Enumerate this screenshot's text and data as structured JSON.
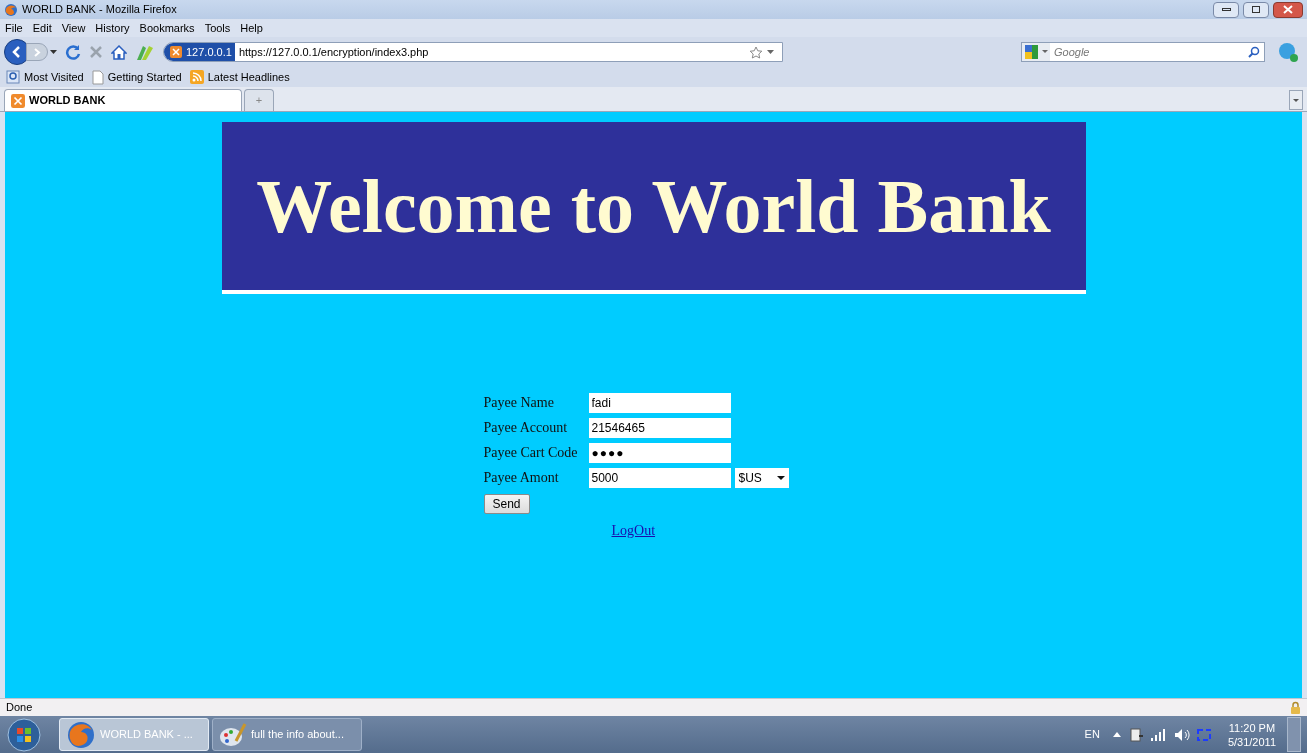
{
  "window": {
    "title": "WORLD BANK - Mozilla Firefox"
  },
  "menu": [
    "File",
    "Edit",
    "View",
    "History",
    "Bookmarks",
    "Tools",
    "Help"
  ],
  "address_bar": {
    "site_badge": "127.0.0.1",
    "url": "https://127.0.0.1/encryption/index3.php"
  },
  "search": {
    "placeholder": "Google"
  },
  "bookmarks": [
    {
      "label": "Most Visited",
      "kind": "search"
    },
    {
      "label": "Getting Started",
      "kind": "page"
    },
    {
      "label": "Latest Headlines",
      "kind": "feed"
    }
  ],
  "tabs": [
    {
      "label": "WORLD BANK",
      "selected": true
    },
    {
      "label": "+",
      "selected": false
    }
  ],
  "page": {
    "banner": "Welcome to World Bank",
    "form": [
      {
        "label": "Payee Name",
        "value": "fadi",
        "kind": "text"
      },
      {
        "label": "Payee Account",
        "value": "21546465",
        "kind": "text"
      },
      {
        "label": "Payee Cart Code",
        "value": "●●●●",
        "kind": "password"
      },
      {
        "label": "Payee Amont",
        "value": "5000",
        "kind": "text",
        "currency": "$US"
      }
    ],
    "submit": "Send",
    "link": "LogOut"
  },
  "status_bar": "Done",
  "taskbar": {
    "items": [
      {
        "label": "WORLD BANK - ...",
        "kind": "browser",
        "selected": true
      },
      {
        "label": "full the info about...",
        "kind": "paint",
        "selected": false
      }
    ],
    "language": "EN",
    "time": "11:20 PM",
    "date": "5/31/2011"
  }
}
